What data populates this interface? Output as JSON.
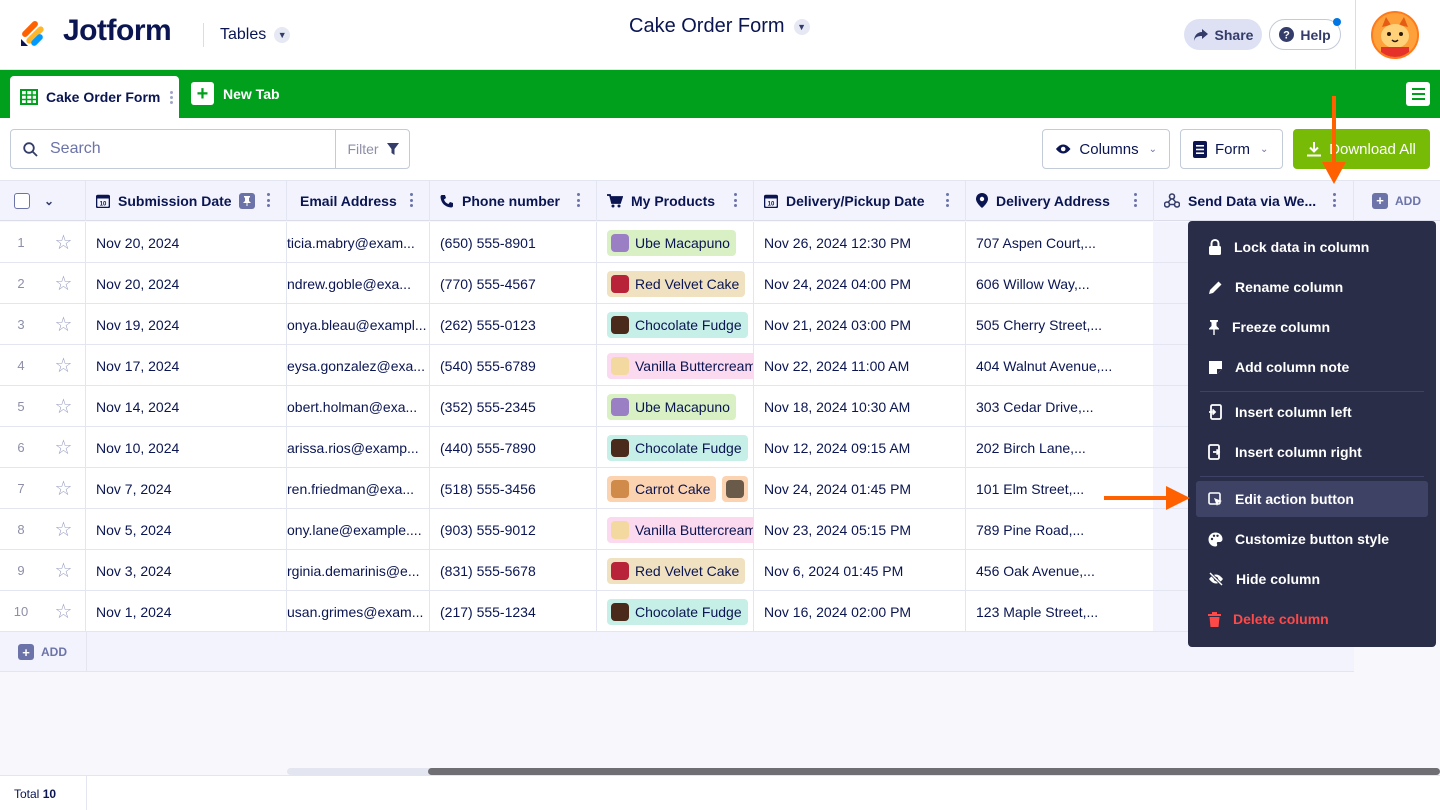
{
  "header": {
    "logo_text": "Jotform",
    "tables_label": "Tables",
    "page_title": "Cake Order Form",
    "share_label": "Share",
    "help_label": "Help"
  },
  "tabs": {
    "active_label": "Cake Order Form",
    "new_tab_label": "New Tab"
  },
  "toolbar": {
    "search_placeholder": "Search",
    "filter_label": "Filter",
    "columns_label": "Columns",
    "form_label": "Form",
    "download_label": "Download All"
  },
  "columns": [
    {
      "label": "Submission Date",
      "icon": "calendar-icon"
    },
    {
      "label": "Email Address",
      "icon": "mail-icon"
    },
    {
      "label": "Phone number",
      "icon": "phone-icon"
    },
    {
      "label": "My Products",
      "icon": "cart-icon"
    },
    {
      "label": "Delivery/Pickup Date",
      "icon": "calendar-icon"
    },
    {
      "label": "Delivery Address",
      "icon": "location-pin-icon"
    },
    {
      "label": "Send Data via We...",
      "icon": "webhook-icon"
    }
  ],
  "add_column_label": "ADD",
  "rows": [
    {
      "num": "1",
      "date": "Nov 20, 2024",
      "email": "ticia.mabry@exam...",
      "phone": "(650) 555-8901",
      "product": "Ube Macapuno",
      "product_color": "#d8f0c4",
      "thumb": "#9b7fc4",
      "delivery": "Nov 26, 2024 12:30 PM",
      "address": "707 Aspen Court,..."
    },
    {
      "num": "2",
      "date": "Nov 20, 2024",
      "email": "ndrew.goble@exa...",
      "phone": "(770) 555-4567",
      "product": "Red Velvet Cake",
      "product_color": "#f0e2c0",
      "thumb": "#b8233a",
      "delivery": "Nov 24, 2024 04:00 PM",
      "address": "606 Willow Way,..."
    },
    {
      "num": "3",
      "date": "Nov 19, 2024",
      "email": "onya.bleau@exampl...",
      "phone": "(262) 555-0123",
      "product": "Chocolate Fudge",
      "product_color": "#c6efe8",
      "thumb": "#4a2a1a",
      "delivery": "Nov 21, 2024 03:00 PM",
      "address": "505 Cherry Street,..."
    },
    {
      "num": "4",
      "date": "Nov 17, 2024",
      "email": "eysa.gonzalez@exa...",
      "phone": "(540) 555-6789",
      "product": "Vanilla Buttercream",
      "product_color": "#fbd9ee",
      "thumb": "#f3d9a0",
      "delivery": "Nov 22, 2024 11:00 AM",
      "address": "404 Walnut Avenue,..."
    },
    {
      "num": "5",
      "date": "Nov 14, 2024",
      "email": "obert.holman@exa...",
      "phone": "(352) 555-2345",
      "product": "Ube Macapuno",
      "product_color": "#d8f0c4",
      "thumb": "#9b7fc4",
      "delivery": "Nov 18, 2024 10:30 AM",
      "address": "303 Cedar Drive,..."
    },
    {
      "num": "6",
      "date": "Nov 10, 2024",
      "email": "arissa.rios@examp...",
      "phone": "(440) 555-7890",
      "product": "Chocolate Fudge",
      "product_color": "#c6efe8",
      "thumb": "#4a2a1a",
      "delivery": "Nov 12, 2024 09:15 AM",
      "address": "202 Birch Lane,..."
    },
    {
      "num": "7",
      "date": "Nov 7, 2024",
      "email": "ren.friedman@exa...",
      "phone": "(518) 555-3456",
      "product": "Carrot Cake",
      "product_color": "#fcd3b0",
      "thumb": "#d08a4a",
      "delivery": "Nov 24, 2024 01:45 PM",
      "address": "101 Elm Street,..."
    },
    {
      "num": "8",
      "date": "Nov 5, 2024",
      "email": "ony.lane@example....",
      "phone": "(903) 555-9012",
      "product": "Vanilla Buttercream",
      "product_color": "#fbd9ee",
      "thumb": "#f3d9a0",
      "delivery": "Nov 23, 2024 05:15 PM",
      "address": "789 Pine Road,..."
    },
    {
      "num": "9",
      "date": "Nov 3, 2024",
      "email": "rginia.demarinis@e...",
      "phone": "(831) 555-5678",
      "product": "Red Velvet Cake",
      "product_color": "#f0e2c0",
      "thumb": "#b8233a",
      "delivery": "Nov 6, 2024 01:45 PM",
      "address": "456 Oak Avenue,..."
    },
    {
      "num": "10",
      "date": "Nov 1, 2024",
      "email": "usan.grimes@exam...",
      "phone": "(217) 555-1234",
      "product": "Chocolate Fudge",
      "product_color": "#c6efe8",
      "thumb": "#4a2a1a",
      "delivery": "Nov 16, 2024 02:00 PM",
      "address": "123 Maple Street,..."
    }
  ],
  "add_row_label": "ADD",
  "footer": {
    "total_label": "Total",
    "total_value": "10"
  },
  "context_menu": {
    "items": [
      {
        "label": "Lock data in column",
        "icon": "lock-icon"
      },
      {
        "label": "Rename column",
        "icon": "pencil-icon"
      },
      {
        "label": "Freeze column",
        "icon": "pin-icon"
      },
      {
        "label": "Add column note",
        "icon": "note-icon"
      },
      {
        "label": "Insert column left",
        "icon": "insert-left-icon"
      },
      {
        "label": "Insert column right",
        "icon": "insert-right-icon"
      },
      {
        "label": "Edit action button",
        "icon": "cursor-click-icon"
      },
      {
        "label": "Customize button style",
        "icon": "palette-icon"
      },
      {
        "label": "Hide column",
        "icon": "eye-slash-icon"
      },
      {
        "label": "Delete column",
        "icon": "trash-icon"
      }
    ]
  },
  "colors": {
    "brand_green": "#01a01c",
    "download_green": "#78bb07",
    "menu_bg": "#292d47",
    "delete_red": "#ff4948",
    "annotation_arrow": "#ff6100"
  }
}
